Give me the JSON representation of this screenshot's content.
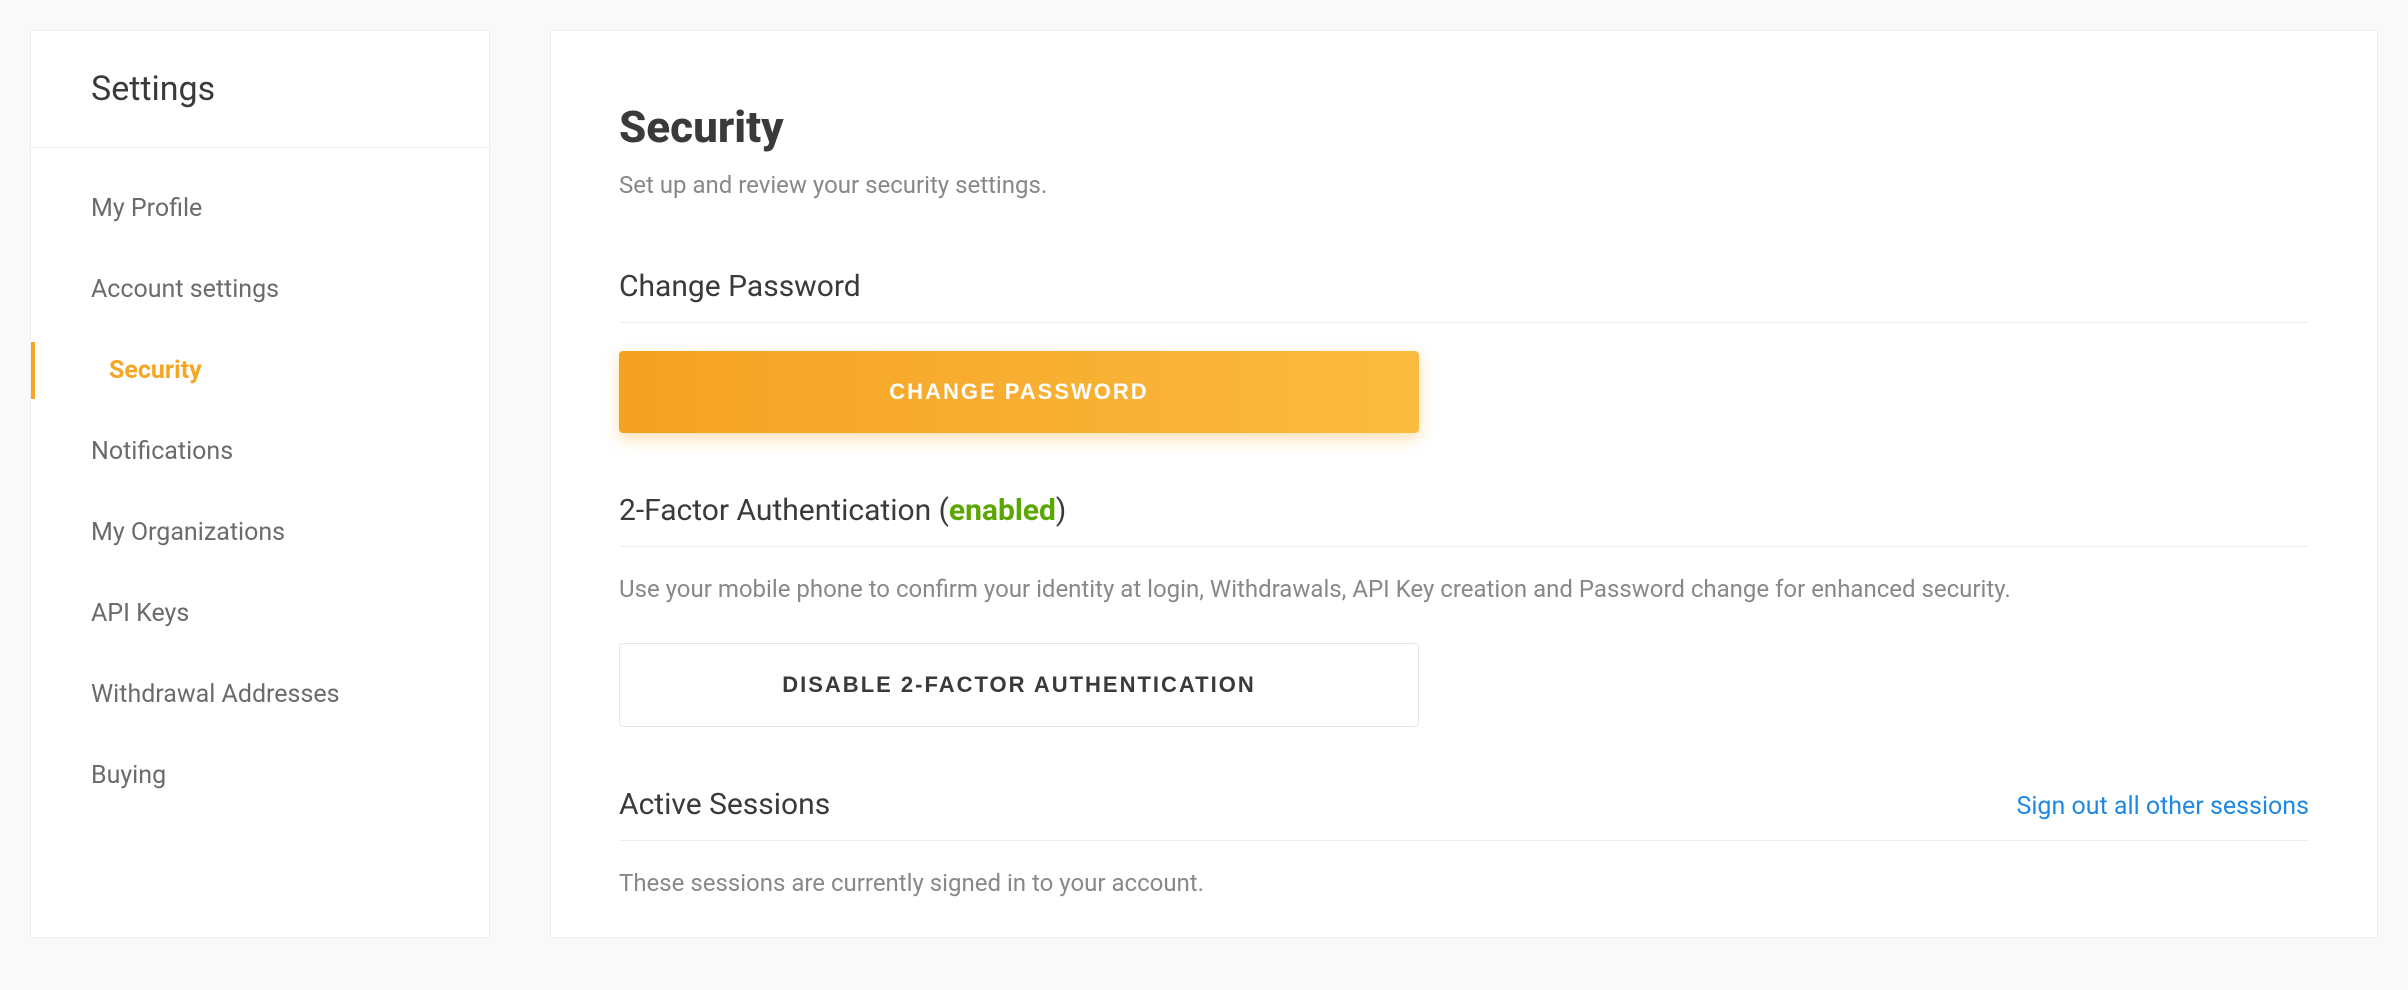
{
  "sidebar": {
    "title": "Settings",
    "items": [
      {
        "label": "My Profile",
        "active": false
      },
      {
        "label": "Account settings",
        "active": false
      },
      {
        "label": "Security",
        "active": true
      },
      {
        "label": "Notifications",
        "active": false
      },
      {
        "label": "My Organizations",
        "active": false
      },
      {
        "label": "API Keys",
        "active": false
      },
      {
        "label": "Withdrawal Addresses",
        "active": false
      },
      {
        "label": "Buying",
        "active": false
      }
    ]
  },
  "main": {
    "title": "Security",
    "subtitle": "Set up and review your security settings.",
    "change_password": {
      "title": "Change Password",
      "button_label": "CHANGE PASSWORD"
    },
    "twofa": {
      "title_prefix": "2-Factor Authentication (",
      "status": "enabled",
      "title_suffix": ")",
      "description": "Use your mobile phone to confirm your identity at login, Withdrawals, API Key creation and Password change for enhanced security.",
      "button_label": "DISABLE 2-FACTOR AUTHENTICATION"
    },
    "sessions": {
      "title": "Active Sessions",
      "signout_link": "Sign out all other sessions",
      "description": "These sessions are currently signed in to your account."
    }
  }
}
